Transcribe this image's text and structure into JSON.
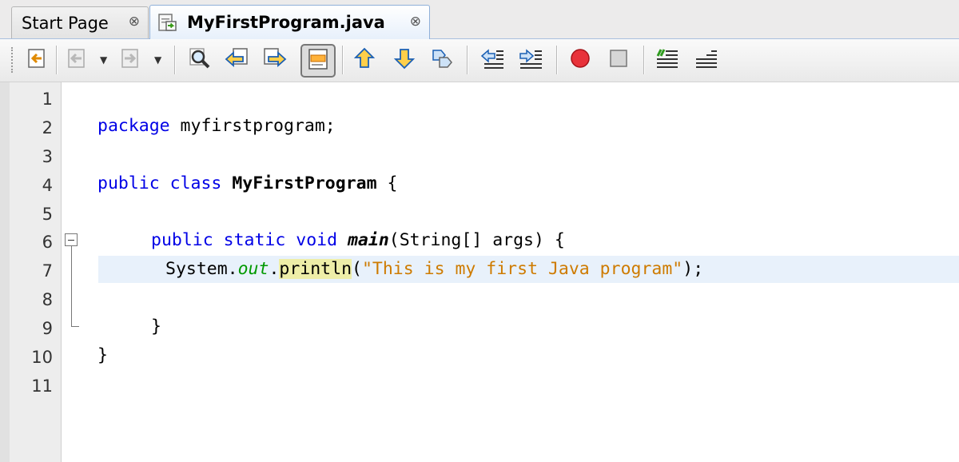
{
  "tabs": [
    {
      "label": "Start Page",
      "active": false,
      "close": "⊗"
    },
    {
      "label": "MyFirstProgram.java",
      "active": true,
      "close": "⊗"
    }
  ],
  "toolbar": {
    "icons": [
      "last-edit-icon",
      "back-icon",
      "forward-icon",
      "find-icon",
      "find-previous-icon",
      "find-next-icon",
      "toggle-highlight-icon",
      "previous-bookmark-icon",
      "next-bookmark-icon",
      "toggle-bookmark-icon",
      "shift-left-icon",
      "shift-right-icon",
      "start-macro-icon",
      "stop-macro-icon",
      "comment-icon",
      "uncomment-icon"
    ]
  },
  "editor": {
    "line_numbers": [
      "1",
      "2",
      "3",
      "4",
      "5",
      "6",
      "7",
      "8",
      "9",
      "10",
      "11"
    ],
    "current_line": 7,
    "colors": {
      "keyword": "#0000e6",
      "string": "#ce7b00",
      "field": "#009900",
      "current_line_bg": "#e8f1fb",
      "method_highlight": "#eeeea8"
    },
    "code": {
      "l2_kw": "package",
      "l2_rest": " myfirstprogram;",
      "l4_kw1": "public",
      "l4_kw2": "class",
      "l4_name": "MyFirstProgram",
      "l4_rest": " {",
      "l6_kw1": "public",
      "l6_kw2": "static",
      "l6_kw3": "void",
      "l6_method": "main",
      "l6_rest": "(String[] args) {",
      "l7_sys": "System.",
      "l7_out": "out",
      "l7_dot": ".",
      "l7_println": "println",
      "l7_open": "(",
      "l7_str": "\"This is my first Java program\"",
      "l7_close": ");",
      "l9": "}",
      "l10": "}"
    }
  }
}
